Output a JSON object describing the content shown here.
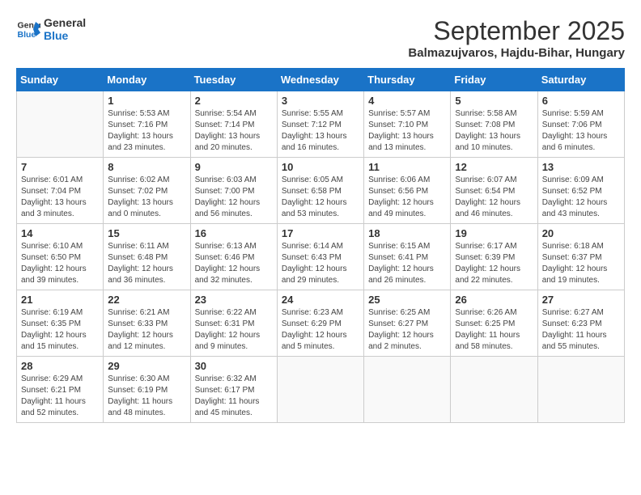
{
  "logo": {
    "line1": "General",
    "line2": "Blue"
  },
  "title": "September 2025",
  "location": "Balmazujvaros, Hajdu-Bihar, Hungary",
  "days_of_week": [
    "Sunday",
    "Monday",
    "Tuesday",
    "Wednesday",
    "Thursday",
    "Friday",
    "Saturday"
  ],
  "weeks": [
    [
      {
        "day": "",
        "content": ""
      },
      {
        "day": "1",
        "content": "Sunrise: 5:53 AM\nSunset: 7:16 PM\nDaylight: 13 hours\nand 23 minutes."
      },
      {
        "day": "2",
        "content": "Sunrise: 5:54 AM\nSunset: 7:14 PM\nDaylight: 13 hours\nand 20 minutes."
      },
      {
        "day": "3",
        "content": "Sunrise: 5:55 AM\nSunset: 7:12 PM\nDaylight: 13 hours\nand 16 minutes."
      },
      {
        "day": "4",
        "content": "Sunrise: 5:57 AM\nSunset: 7:10 PM\nDaylight: 13 hours\nand 13 minutes."
      },
      {
        "day": "5",
        "content": "Sunrise: 5:58 AM\nSunset: 7:08 PM\nDaylight: 13 hours\nand 10 minutes."
      },
      {
        "day": "6",
        "content": "Sunrise: 5:59 AM\nSunset: 7:06 PM\nDaylight: 13 hours\nand 6 minutes."
      }
    ],
    [
      {
        "day": "7",
        "content": "Sunrise: 6:01 AM\nSunset: 7:04 PM\nDaylight: 13 hours\nand 3 minutes."
      },
      {
        "day": "8",
        "content": "Sunrise: 6:02 AM\nSunset: 7:02 PM\nDaylight: 13 hours\nand 0 minutes."
      },
      {
        "day": "9",
        "content": "Sunrise: 6:03 AM\nSunset: 7:00 PM\nDaylight: 12 hours\nand 56 minutes."
      },
      {
        "day": "10",
        "content": "Sunrise: 6:05 AM\nSunset: 6:58 PM\nDaylight: 12 hours\nand 53 minutes."
      },
      {
        "day": "11",
        "content": "Sunrise: 6:06 AM\nSunset: 6:56 PM\nDaylight: 12 hours\nand 49 minutes."
      },
      {
        "day": "12",
        "content": "Sunrise: 6:07 AM\nSunset: 6:54 PM\nDaylight: 12 hours\nand 46 minutes."
      },
      {
        "day": "13",
        "content": "Sunrise: 6:09 AM\nSunset: 6:52 PM\nDaylight: 12 hours\nand 43 minutes."
      }
    ],
    [
      {
        "day": "14",
        "content": "Sunrise: 6:10 AM\nSunset: 6:50 PM\nDaylight: 12 hours\nand 39 minutes."
      },
      {
        "day": "15",
        "content": "Sunrise: 6:11 AM\nSunset: 6:48 PM\nDaylight: 12 hours\nand 36 minutes."
      },
      {
        "day": "16",
        "content": "Sunrise: 6:13 AM\nSunset: 6:46 PM\nDaylight: 12 hours\nand 32 minutes."
      },
      {
        "day": "17",
        "content": "Sunrise: 6:14 AM\nSunset: 6:43 PM\nDaylight: 12 hours\nand 29 minutes."
      },
      {
        "day": "18",
        "content": "Sunrise: 6:15 AM\nSunset: 6:41 PM\nDaylight: 12 hours\nand 26 minutes."
      },
      {
        "day": "19",
        "content": "Sunrise: 6:17 AM\nSunset: 6:39 PM\nDaylight: 12 hours\nand 22 minutes."
      },
      {
        "day": "20",
        "content": "Sunrise: 6:18 AM\nSunset: 6:37 PM\nDaylight: 12 hours\nand 19 minutes."
      }
    ],
    [
      {
        "day": "21",
        "content": "Sunrise: 6:19 AM\nSunset: 6:35 PM\nDaylight: 12 hours\nand 15 minutes."
      },
      {
        "day": "22",
        "content": "Sunrise: 6:21 AM\nSunset: 6:33 PM\nDaylight: 12 hours\nand 12 minutes."
      },
      {
        "day": "23",
        "content": "Sunrise: 6:22 AM\nSunset: 6:31 PM\nDaylight: 12 hours\nand 9 minutes."
      },
      {
        "day": "24",
        "content": "Sunrise: 6:23 AM\nSunset: 6:29 PM\nDaylight: 12 hours\nand 5 minutes."
      },
      {
        "day": "25",
        "content": "Sunrise: 6:25 AM\nSunset: 6:27 PM\nDaylight: 12 hours\nand 2 minutes."
      },
      {
        "day": "26",
        "content": "Sunrise: 6:26 AM\nSunset: 6:25 PM\nDaylight: 11 hours\nand 58 minutes."
      },
      {
        "day": "27",
        "content": "Sunrise: 6:27 AM\nSunset: 6:23 PM\nDaylight: 11 hours\nand 55 minutes."
      }
    ],
    [
      {
        "day": "28",
        "content": "Sunrise: 6:29 AM\nSunset: 6:21 PM\nDaylight: 11 hours\nand 52 minutes."
      },
      {
        "day": "29",
        "content": "Sunrise: 6:30 AM\nSunset: 6:19 PM\nDaylight: 11 hours\nand 48 minutes."
      },
      {
        "day": "30",
        "content": "Sunrise: 6:32 AM\nSunset: 6:17 PM\nDaylight: 11 hours\nand 45 minutes."
      },
      {
        "day": "",
        "content": ""
      },
      {
        "day": "",
        "content": ""
      },
      {
        "day": "",
        "content": ""
      },
      {
        "day": "",
        "content": ""
      }
    ]
  ]
}
